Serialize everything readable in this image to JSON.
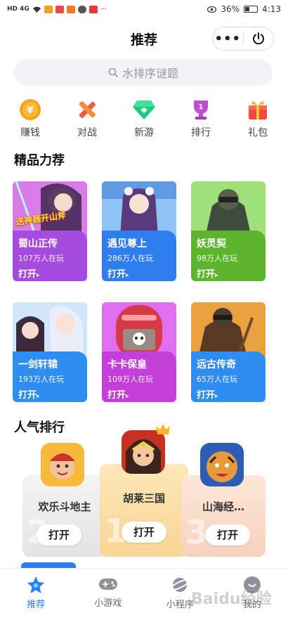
{
  "status_bar": {
    "left_text": "HD 4G",
    "battery": "36%",
    "time": "4:13"
  },
  "header": {
    "title": "推荐",
    "more_label": "•••"
  },
  "search": {
    "placeholder": "水排序谜题"
  },
  "quick_nav": [
    {
      "label": "赚钱",
      "icon": "coin-icon"
    },
    {
      "label": "对战",
      "icon": "crossed-swords-icon"
    },
    {
      "label": "新游",
      "icon": "gem-icon"
    },
    {
      "label": "排行",
      "icon": "trophy-icon"
    },
    {
      "label": "礼包",
      "icon": "gift-icon"
    }
  ],
  "featured": {
    "title": "精品力荐",
    "banner_text": "送神器开山斧",
    "play_label": "打开",
    "games": [
      {
        "name": "蜀山正传",
        "players": "107万人在玩",
        "color": "#a54be0"
      },
      {
        "name": "遇见尊上",
        "players": "286万人在玩",
        "color": "#2f7ef0"
      },
      {
        "name": "妖灵契",
        "players": "98万人在玩",
        "color": "#5cb52c"
      },
      {
        "name": "一剑轩辕",
        "players": "193万人在玩",
        "color": "#2f8cf0"
      },
      {
        "name": "卡卡保皇",
        "players": "109万人在玩",
        "color": "#c43fd8"
      },
      {
        "name": "远古传奇",
        "players": "65万人在玩",
        "color": "#2f8cf0"
      }
    ]
  },
  "ranking": {
    "title": "人气排行",
    "play_label": "打开",
    "items": [
      {
        "rank": "2",
        "name": "欢乐斗地主"
      },
      {
        "rank": "1",
        "name": "胡莱三国"
      },
      {
        "rank": "3",
        "name": "山海经…"
      }
    ]
  },
  "tabbar": [
    {
      "label": "推荐",
      "icon": "star-icon",
      "active": true
    },
    {
      "label": "小游戏",
      "icon": "gamepad-icon",
      "active": false
    },
    {
      "label": "小程序",
      "icon": "planet-icon",
      "active": false
    },
    {
      "label": "我的",
      "icon": "profile-icon",
      "active": false
    }
  ],
  "watermark": "Baidu经验"
}
